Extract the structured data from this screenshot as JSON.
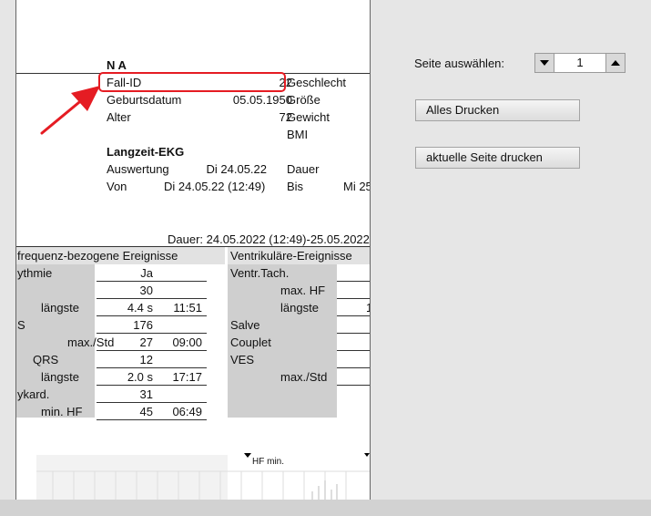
{
  "report": {
    "patient_name": "N A",
    "fields": {
      "fall_id_label": "Fall-ID",
      "fall_id_value": "22",
      "geburtsdatum_label": "Geburtsdatum",
      "geburtsdatum_value": "05.05.1950",
      "alter_label": "Alter",
      "alter_value": "72",
      "geschlecht_label": "Geschlecht",
      "groesse_label": "Größe",
      "gewicht_label": "Gewicht",
      "bmi_label": "BMI"
    },
    "section_title": "Langzeit-EKG",
    "auswertung_label": "Auswertung",
    "auswertung_value": "Di 24.05.22",
    "von_label": "Von",
    "von_value": "Di 24.05.22 (12:49)",
    "dauer_label": "Dauer",
    "bis_label": "Bis",
    "bis_value": "Mi 25",
    "duration_line": "Dauer: 24.05.2022 (12:49)-25.05.2022",
    "left_table": {
      "header": "frequenz-bezogene Ereignisse",
      "rows": [
        {
          "label": "ythmie",
          "value": "Ja",
          "time": ""
        },
        {
          "label": "",
          "value": "30",
          "time": ""
        },
        {
          "label": "längste",
          "value": "4.4 s",
          "time": "11:51"
        },
        {
          "label": "S",
          "value": "176",
          "time": ""
        },
        {
          "label": "max./Std",
          "value": "27",
          "time": "09:00"
        },
        {
          "label": "QRS",
          "value": "12",
          "time": ""
        },
        {
          "label": "längste",
          "value": "2.0 s",
          "time": "17:17"
        },
        {
          "label": "ykard.",
          "value": "31",
          "time": ""
        },
        {
          "label": "min. HF",
          "value": "45",
          "time": "06:49"
        }
      ]
    },
    "right_table": {
      "header": "Ventrikuläre-Ereignisse",
      "rows": [
        "Ventr.Tach.",
        "max. HF",
        "längste",
        "Salve",
        "Couplet",
        "VES",
        "max./Std"
      ],
      "partial_value": "1"
    },
    "chart_label": "HF min."
  },
  "panel": {
    "page_select_label": "Seite auswählen:",
    "page_value": "1",
    "print_all_label": "Alles Drucken",
    "print_current_label": "aktuelle Seite drucken"
  },
  "colors": {
    "highlight": "#e51c23",
    "shade": "#cfcfcf",
    "background": "#e6e6e6"
  }
}
